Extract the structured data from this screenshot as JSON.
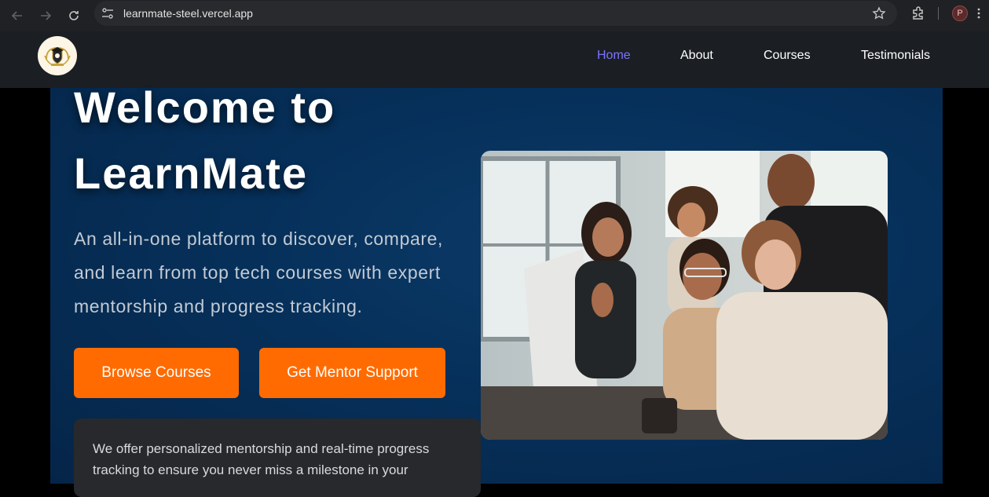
{
  "browser": {
    "url": "learnmate-steel.vercel.app",
    "profile_initial": "P",
    "icons": [
      "back-arrow-icon",
      "forward-arrow-icon",
      "reload-icon",
      "site-settings-icon",
      "bookmark-star-icon",
      "extensions-icon",
      "more-menu-icon"
    ]
  },
  "nav": {
    "links": [
      "Home",
      "About",
      "Courses",
      "Testimonials"
    ],
    "active": "Home",
    "active_color": "#7b74ff"
  },
  "hero": {
    "title_line1": "Welcome to",
    "title_line2": "LearnMate",
    "subtitle_lines": [
      "An all-in-one platform to discover, compare,",
      "and learn from top tech courses with expert",
      "mentorship and progress tracking."
    ],
    "buttons": {
      "browse": "Browse Courses",
      "mentor": "Get Mentor Support"
    },
    "button_color": "#ff6b00",
    "card_lines": [
      "We offer personalized mentorship and real-time progress",
      "tracking to ensure you never miss a milestone in your"
    ]
  }
}
